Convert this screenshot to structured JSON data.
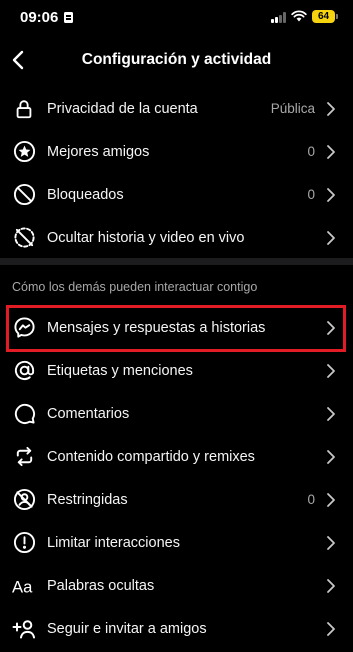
{
  "status_bar": {
    "time": "09:06",
    "battery": "64",
    "battery_color": "#f5d30f"
  },
  "header": {
    "title": "Configuración y actividad"
  },
  "section_title": "Cómo los demás pueden interactuar contigo",
  "highlight_color": "#e11c24",
  "items": [
    {
      "label": "Privacidad de la cuenta",
      "value": "Pública",
      "icon": "lock-icon"
    },
    {
      "label": "Mejores amigos",
      "value": "0",
      "icon": "star-circle-icon"
    },
    {
      "label": "Bloqueados",
      "value": "0",
      "icon": "blocked-icon"
    },
    {
      "label": "Ocultar historia y video en vivo",
      "value": "",
      "icon": "hide-story-icon"
    },
    {
      "label": "Mensajes y respuestas a historias",
      "value": "",
      "icon": "messenger-icon"
    },
    {
      "label": "Etiquetas y menciones",
      "value": "",
      "icon": "at-sign-icon"
    },
    {
      "label": "Comentarios",
      "value": "",
      "icon": "comment-icon"
    },
    {
      "label": "Contenido compartido y remixes",
      "value": "",
      "icon": "share-remix-icon"
    },
    {
      "label": "Restringidas",
      "value": "0",
      "icon": "restricted-icon"
    },
    {
      "label": "Limitar interacciones",
      "value": "",
      "icon": "limit-alert-icon"
    },
    {
      "label": "Palabras ocultas",
      "value": "",
      "icon": "hidden-words-icon"
    },
    {
      "label": "Seguir e invitar a amigos",
      "value": "",
      "icon": "add-friend-icon"
    }
  ]
}
